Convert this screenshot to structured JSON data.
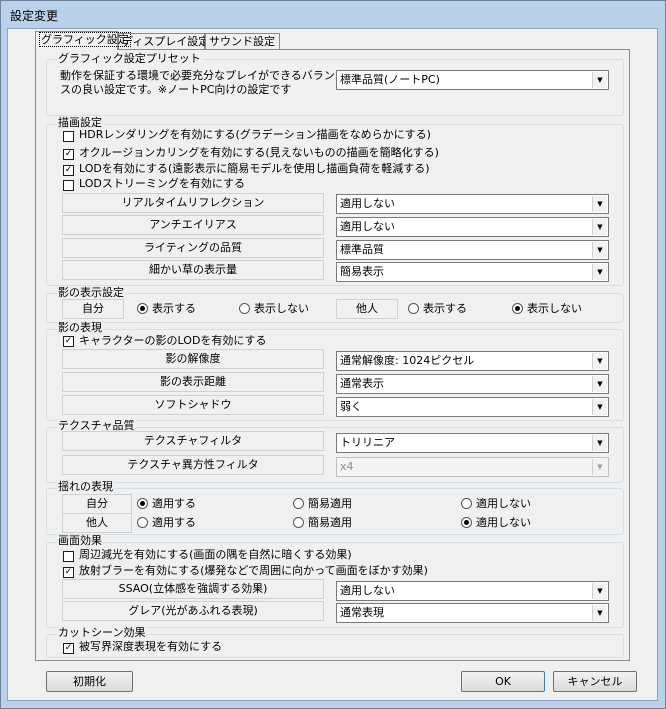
{
  "window": {
    "title": "設定変更"
  },
  "tabs": [
    "グラフィック設定",
    "ディスプレイ設定",
    "サウンド設定"
  ],
  "preset": {
    "legend": "グラフィック設定プリセット",
    "description_line1": "動作を保証する環境で必要充分なプレイができるバラン",
    "description_line2": "スの良い設定です。※ノートPC向けの設定です",
    "value": "標準品質(ノートPC)"
  },
  "rendering": {
    "legend": "描画設定",
    "checkboxes": [
      {
        "label": "HDRレンダリングを有効にする(グラデーション描画をなめらかにする)",
        "checked": false
      },
      {
        "label": "オクルージョンカリングを有効にする(見えないものの描画を簡略化する)",
        "checked": true
      },
      {
        "label": "LODを有効にする(遠影表示に簡易モデルを使用し描画負荷を軽減する)",
        "checked": true
      },
      {
        "label": "LODストリーミングを有効にする",
        "checked": false
      }
    ],
    "rows": [
      {
        "label": "リアルタイムリフレクション",
        "value": "適用しない"
      },
      {
        "label": "アンチエイリアス",
        "value": "適用しない"
      },
      {
        "label": "ライティングの品質",
        "value": "標準品質"
      },
      {
        "label": "細かい草の表示量",
        "value": "簡易表示"
      }
    ]
  },
  "shadow_display": {
    "legend": "影の表示設定",
    "self_label": "自分",
    "other_label": "他人",
    "show": "表示する",
    "hide": "表示しない",
    "self_selected": "show",
    "other_selected": "hide"
  },
  "shadow_expression": {
    "legend": "影の表現",
    "checkbox": {
      "label": "キャラクターの影のLODを有効にする",
      "checked": true
    },
    "rows": [
      {
        "label": "影の解像度",
        "value": "通常解像度: 1024ピクセル"
      },
      {
        "label": "影の表示距離",
        "value": "通常表示"
      },
      {
        "label": "ソフトシャドウ",
        "value": "弱く"
      }
    ]
  },
  "texture": {
    "legend": "テクスチャ品質",
    "rows": [
      {
        "label": "テクスチャフィルタ",
        "value": "トリリニア",
        "enabled": true
      },
      {
        "label": "テクスチャ異方性フィルタ",
        "value": "x4",
        "enabled": false
      }
    ]
  },
  "sway": {
    "legend": "揺れの表現",
    "self_label": "自分",
    "other_label": "他人",
    "options": [
      "適用する",
      "簡易適用",
      "適用しない"
    ],
    "self_selected": 0,
    "other_selected": 2
  },
  "screen_effects": {
    "legend": "画面効果",
    "checkboxes": [
      {
        "label": "周辺減光を有効にする(画面の隅を自然に暗くする効果)",
        "checked": false
      },
      {
        "label": "放射ブラーを有効にする(爆発などで周囲に向かって画面をぼかす効果)",
        "checked": true
      }
    ],
    "rows": [
      {
        "label": "SSAO(立体感を強調する効果)",
        "value": "適用しない"
      },
      {
        "label": "グレア(光があふれる表現)",
        "value": "通常表現"
      }
    ]
  },
  "cutscene": {
    "legend": "カットシーン効果",
    "checkbox": {
      "label": "被写界深度表現を有効にする",
      "checked": true
    }
  },
  "buttons": {
    "reset": "初期化",
    "ok": "OK",
    "cancel": "キャンセル"
  },
  "colors": {
    "frame": "#b9d1ea",
    "client": "#f0f0f0"
  }
}
